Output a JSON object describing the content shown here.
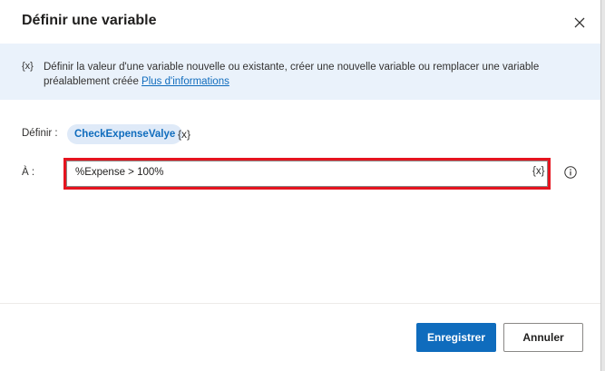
{
  "dialog": {
    "title": "Définir une variable",
    "close_icon": "close-icon"
  },
  "banner": {
    "icon_text": "{x}",
    "text": "Définir la valeur d'une variable nouvelle ou existante, créer une nouvelle variable ou remplacer une variable préalablement créée",
    "link": "Plus d'informations"
  },
  "form": {
    "set_label": "Définir :",
    "variable_name": "CheckExpenseValye",
    "variable_icon_text": "{x}",
    "to_label": "À :",
    "value": "%Expense > 100%",
    "value_icon_text": "{x}",
    "info_icon": "info-icon",
    "highlight_color": "#e5141f"
  },
  "footer": {
    "save_label": "Enregistrer",
    "cancel_label": "Annuler"
  },
  "colors": {
    "accent": "#0f6cbd",
    "banner_bg": "#eaf2fb",
    "chip_bg": "#dfeaf8"
  }
}
